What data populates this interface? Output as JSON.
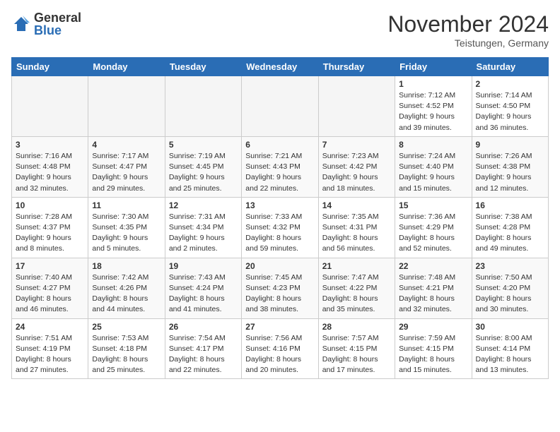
{
  "logo": {
    "general": "General",
    "blue": "Blue"
  },
  "title": "November 2024",
  "location": "Teistungen, Germany",
  "days_of_week": [
    "Sunday",
    "Monday",
    "Tuesday",
    "Wednesday",
    "Thursday",
    "Friday",
    "Saturday"
  ],
  "weeks": [
    [
      {
        "day": "",
        "info": ""
      },
      {
        "day": "",
        "info": ""
      },
      {
        "day": "",
        "info": ""
      },
      {
        "day": "",
        "info": ""
      },
      {
        "day": "",
        "info": ""
      },
      {
        "day": "1",
        "info": "Sunrise: 7:12 AM\nSunset: 4:52 PM\nDaylight: 9 hours\nand 39 minutes."
      },
      {
        "day": "2",
        "info": "Sunrise: 7:14 AM\nSunset: 4:50 PM\nDaylight: 9 hours\nand 36 minutes."
      }
    ],
    [
      {
        "day": "3",
        "info": "Sunrise: 7:16 AM\nSunset: 4:48 PM\nDaylight: 9 hours\nand 32 minutes."
      },
      {
        "day": "4",
        "info": "Sunrise: 7:17 AM\nSunset: 4:47 PM\nDaylight: 9 hours\nand 29 minutes."
      },
      {
        "day": "5",
        "info": "Sunrise: 7:19 AM\nSunset: 4:45 PM\nDaylight: 9 hours\nand 25 minutes."
      },
      {
        "day": "6",
        "info": "Sunrise: 7:21 AM\nSunset: 4:43 PM\nDaylight: 9 hours\nand 22 minutes."
      },
      {
        "day": "7",
        "info": "Sunrise: 7:23 AM\nSunset: 4:42 PM\nDaylight: 9 hours\nand 18 minutes."
      },
      {
        "day": "8",
        "info": "Sunrise: 7:24 AM\nSunset: 4:40 PM\nDaylight: 9 hours\nand 15 minutes."
      },
      {
        "day": "9",
        "info": "Sunrise: 7:26 AM\nSunset: 4:38 PM\nDaylight: 9 hours\nand 12 minutes."
      }
    ],
    [
      {
        "day": "10",
        "info": "Sunrise: 7:28 AM\nSunset: 4:37 PM\nDaylight: 9 hours\nand 8 minutes."
      },
      {
        "day": "11",
        "info": "Sunrise: 7:30 AM\nSunset: 4:35 PM\nDaylight: 9 hours\nand 5 minutes."
      },
      {
        "day": "12",
        "info": "Sunrise: 7:31 AM\nSunset: 4:34 PM\nDaylight: 9 hours\nand 2 minutes."
      },
      {
        "day": "13",
        "info": "Sunrise: 7:33 AM\nSunset: 4:32 PM\nDaylight: 8 hours\nand 59 minutes."
      },
      {
        "day": "14",
        "info": "Sunrise: 7:35 AM\nSunset: 4:31 PM\nDaylight: 8 hours\nand 56 minutes."
      },
      {
        "day": "15",
        "info": "Sunrise: 7:36 AM\nSunset: 4:29 PM\nDaylight: 8 hours\nand 52 minutes."
      },
      {
        "day": "16",
        "info": "Sunrise: 7:38 AM\nSunset: 4:28 PM\nDaylight: 8 hours\nand 49 minutes."
      }
    ],
    [
      {
        "day": "17",
        "info": "Sunrise: 7:40 AM\nSunset: 4:27 PM\nDaylight: 8 hours\nand 46 minutes."
      },
      {
        "day": "18",
        "info": "Sunrise: 7:42 AM\nSunset: 4:26 PM\nDaylight: 8 hours\nand 44 minutes."
      },
      {
        "day": "19",
        "info": "Sunrise: 7:43 AM\nSunset: 4:24 PM\nDaylight: 8 hours\nand 41 minutes."
      },
      {
        "day": "20",
        "info": "Sunrise: 7:45 AM\nSunset: 4:23 PM\nDaylight: 8 hours\nand 38 minutes."
      },
      {
        "day": "21",
        "info": "Sunrise: 7:47 AM\nSunset: 4:22 PM\nDaylight: 8 hours\nand 35 minutes."
      },
      {
        "day": "22",
        "info": "Sunrise: 7:48 AM\nSunset: 4:21 PM\nDaylight: 8 hours\nand 32 minutes."
      },
      {
        "day": "23",
        "info": "Sunrise: 7:50 AM\nSunset: 4:20 PM\nDaylight: 8 hours\nand 30 minutes."
      }
    ],
    [
      {
        "day": "24",
        "info": "Sunrise: 7:51 AM\nSunset: 4:19 PM\nDaylight: 8 hours\nand 27 minutes."
      },
      {
        "day": "25",
        "info": "Sunrise: 7:53 AM\nSunset: 4:18 PM\nDaylight: 8 hours\nand 25 minutes."
      },
      {
        "day": "26",
        "info": "Sunrise: 7:54 AM\nSunset: 4:17 PM\nDaylight: 8 hours\nand 22 minutes."
      },
      {
        "day": "27",
        "info": "Sunrise: 7:56 AM\nSunset: 4:16 PM\nDaylight: 8 hours\nand 20 minutes."
      },
      {
        "day": "28",
        "info": "Sunrise: 7:57 AM\nSunset: 4:15 PM\nDaylight: 8 hours\nand 17 minutes."
      },
      {
        "day": "29",
        "info": "Sunrise: 7:59 AM\nSunset: 4:15 PM\nDaylight: 8 hours\nand 15 minutes."
      },
      {
        "day": "30",
        "info": "Sunrise: 8:00 AM\nSunset: 4:14 PM\nDaylight: 8 hours\nand 13 minutes."
      }
    ]
  ]
}
